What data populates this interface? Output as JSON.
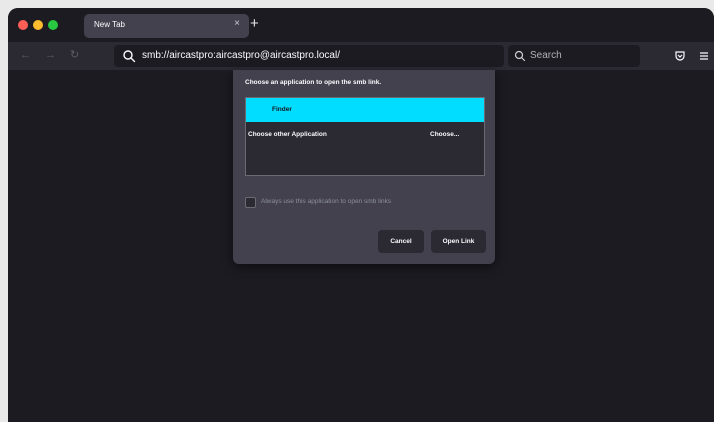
{
  "window": {
    "controls": [
      "close",
      "minimize",
      "maximize"
    ]
  },
  "tab": {
    "title": "New Tab",
    "close_icon": "×",
    "new_tab_icon": "+"
  },
  "toolbar": {
    "back_icon": "←",
    "forward_icon": "→",
    "reload_icon": "↻",
    "url": "smb://aircastpro:aircastpro@aircastpro.local/",
    "search_placeholder": "Search"
  },
  "dialog": {
    "title": "Choose an application to open the smb link.",
    "apps": [
      {
        "name": "Finder",
        "selected": true
      }
    ],
    "other_label": "Choose other Application",
    "choose_button": "Choose...",
    "checkbox_label": "Always use this application to open smb links",
    "checkbox_checked": false,
    "cancel_button": "Cancel",
    "open_button": "Open Link"
  },
  "colors": {
    "accent": "#00ddff",
    "frame": "#1c1b22",
    "toolbar": "#2b2a33",
    "dialog": "#42414d"
  }
}
